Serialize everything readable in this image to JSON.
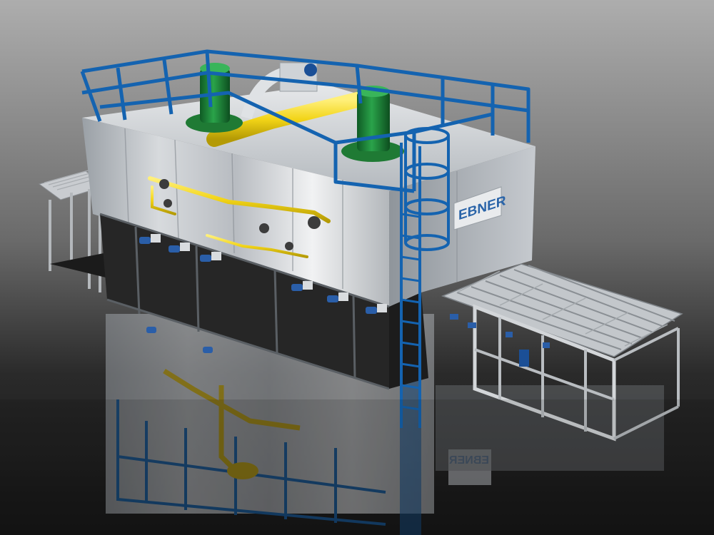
{
  "scene": {
    "brand_label": "EBNER",
    "brand_label_reflection": "EBNER",
    "colors": {
      "background_top": "#a9a9a9",
      "background_bottom": "#1c1c1c",
      "furnace_steel": "#c9cdd2",
      "railing_blue": "#1463b0",
      "motor_green": "#1f8a3a",
      "pipe_yellow": "#f2d417",
      "brand_blue": "#2a64a8"
    }
  }
}
